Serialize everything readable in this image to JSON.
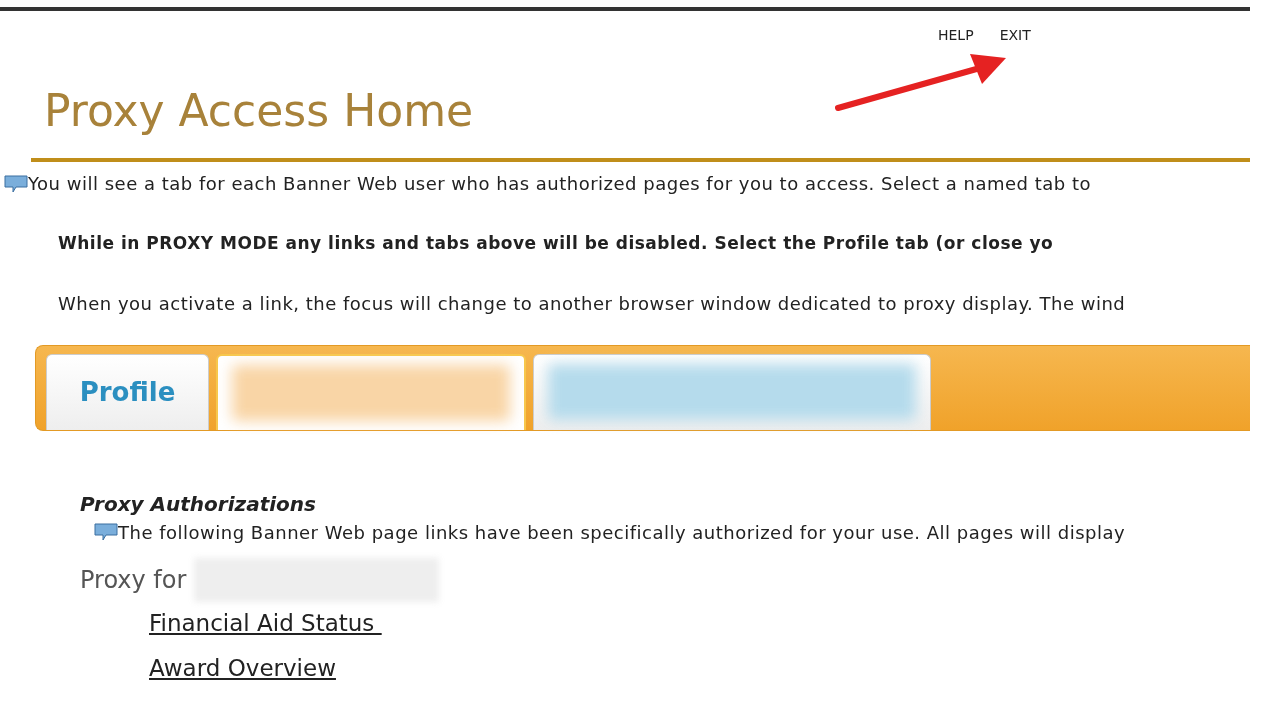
{
  "top_links": [
    {
      "label": "HELP"
    },
    {
      "label": "EXIT"
    }
  ],
  "annotation": {
    "kind": "arrow"
  },
  "title": "Proxy Access Home",
  "info_text": "You will see a tab for each Banner Web user who has authorized pages for you to access. Select a named tab to",
  "warning_text": "While in PROXY MODE any links and tabs above will be disabled. Select the Profile tab (or close yo",
  "focus_text": "When you activate a link, the focus will change to another browser window dedicated to proxy display. The wind",
  "tabs": [
    {
      "kind": "text",
      "label": "Profile",
      "selected": false
    },
    {
      "kind": "redacted",
      "color": "#f9d5a6",
      "selected": true
    },
    {
      "kind": "redacted",
      "color": "#b5dbec",
      "selected": false
    }
  ],
  "section_title": "Proxy Authorizations",
  "section_info": "The following Banner Web page links have been specifically authorized for your use. All pages will display",
  "proxy_label": "Proxy for",
  "proxy_name_redacted": true,
  "links": [
    {
      "label": "Financial Aid Status "
    },
    {
      "label": "Award Overview"
    }
  ]
}
